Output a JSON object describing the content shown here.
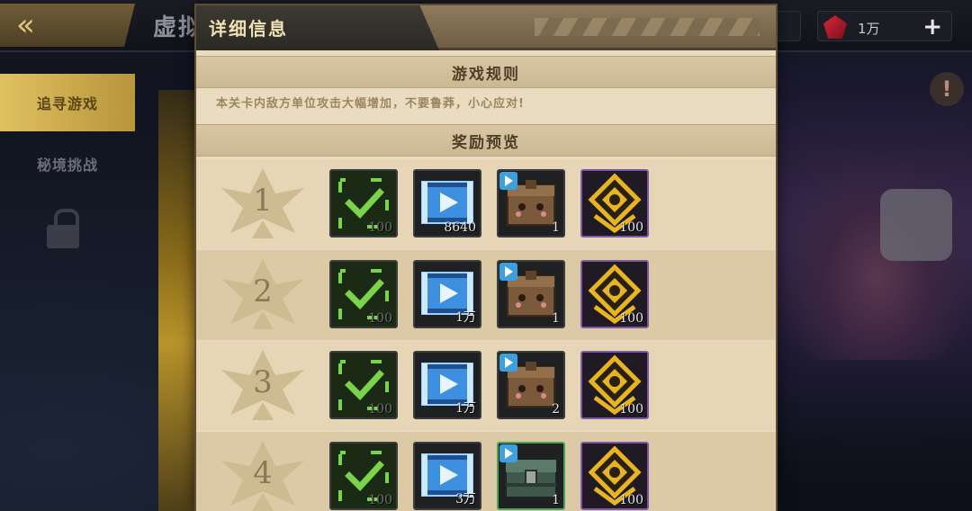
{
  "header": {
    "back_label": "",
    "page_title": "虚拟",
    "currency_amount": "1万"
  },
  "side_nav": {
    "tabs": [
      {
        "label": "追寻游戏",
        "active": true
      },
      {
        "label": "秘境挑战",
        "active": false
      }
    ]
  },
  "modal": {
    "title": "详细信息",
    "rules_heading": "游戏规则",
    "rules_text": "本关卡内敌方单位攻击大幅增加，不要鲁莽，小心应对!",
    "rewards_heading": "奖励预览",
    "rows": [
      {
        "rank": "1",
        "items": [
          {
            "icon": "green-check-token-icon",
            "qty": "100"
          },
          {
            "icon": "blue-film-reel-icon",
            "qty": "8640"
          },
          {
            "icon": "wooden-treasure-box-icon",
            "qty": "1"
          },
          {
            "icon": "gold-rank-badge-icon",
            "qty": "100"
          }
        ]
      },
      {
        "rank": "2",
        "items": [
          {
            "icon": "green-check-token-icon",
            "qty": "100"
          },
          {
            "icon": "blue-film-reel-icon",
            "qty": "1万"
          },
          {
            "icon": "wooden-treasure-box-icon",
            "qty": "1"
          },
          {
            "icon": "gold-rank-badge-icon",
            "qty": "100"
          }
        ]
      },
      {
        "rank": "3",
        "items": [
          {
            "icon": "green-check-token-icon",
            "qty": "100"
          },
          {
            "icon": "blue-film-reel-icon",
            "qty": "1万"
          },
          {
            "icon": "wooden-treasure-box-icon",
            "qty": "2"
          },
          {
            "icon": "gold-rank-badge-icon",
            "qty": "100"
          }
        ]
      },
      {
        "rank": "4",
        "items": [
          {
            "icon": "green-check-token-icon",
            "qty": "100"
          },
          {
            "icon": "blue-film-reel-icon",
            "qty": "3万"
          },
          {
            "icon": "green-iron-chest-icon",
            "qty": "1"
          },
          {
            "icon": "gold-rank-badge-icon",
            "qty": "100"
          }
        ]
      }
    ]
  },
  "colors": {
    "panel_bg": "#e9dcc1",
    "header_bg": "#6e5e45",
    "rank_text": "#8a7a5a",
    "active_tab": "#e0c160",
    "check_green": "#7bd34a",
    "reel_blue": "#3d8fe0",
    "badge_gold": "#e8b520"
  }
}
